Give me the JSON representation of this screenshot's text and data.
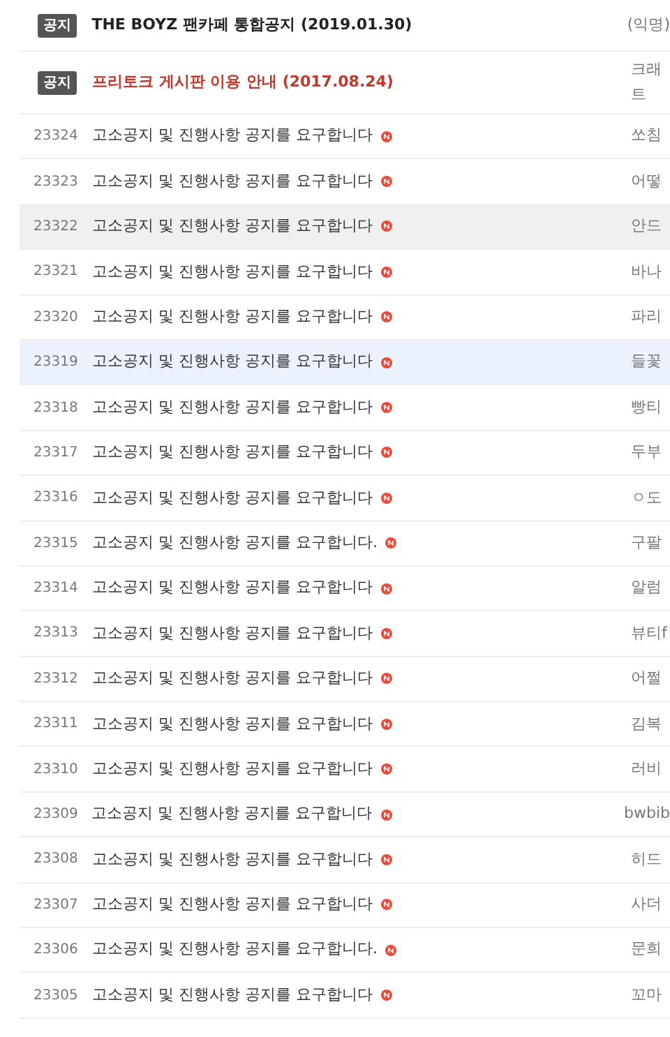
{
  "notices": [
    {
      "badge": "공지",
      "title": "THE BOYZ 팬카페 통합공지 (2019.01.30)",
      "red": false,
      "author": [
        "(익명)"
      ]
    },
    {
      "badge": "공지",
      "title": "프리토크 게시판 이용 안내 (2017.08.24)",
      "red": true,
      "author": [
        "크래",
        "트"
      ]
    }
  ],
  "posts": [
    {
      "number": "23324",
      "title": "고소공지 및 진행사항 공지를 요구합니다",
      "new": true,
      "author": "쏘침",
      "hovered": false,
      "selected": false
    },
    {
      "number": "23323",
      "title": "고소공지 및 진행사항 공지를 요구합니다",
      "new": true,
      "author": "어떻",
      "hovered": false,
      "selected": false
    },
    {
      "number": "23322",
      "title": "고소공지 및 진행사항 공지를 요구합니다",
      "new": true,
      "author": "안드",
      "hovered": true,
      "selected": false
    },
    {
      "number": "23321",
      "title": "고소공지 및 진행사항 공지를 요구합니다",
      "new": true,
      "author": "바나",
      "hovered": false,
      "selected": false
    },
    {
      "number": "23320",
      "title": "고소공지 및 진행사항 공지를 요구합니다",
      "new": true,
      "author": "파리",
      "hovered": false,
      "selected": false
    },
    {
      "number": "23319",
      "title": "고소공지 및 진행사항 공지를 요구합니다",
      "new": true,
      "author": "들꽃",
      "hovered": false,
      "selected": true
    },
    {
      "number": "23318",
      "title": "고소공지 및 진행사항 공지를 요구합니다",
      "new": true,
      "author": "빵티",
      "hovered": false,
      "selected": false
    },
    {
      "number": "23317",
      "title": "고소공지 및 진행사항 공지를 요구합니다",
      "new": true,
      "author": "두부",
      "hovered": false,
      "selected": false
    },
    {
      "number": "23316",
      "title": "고소공지 및 진행사항 공지를 요구합니다",
      "new": true,
      "author": "ㅇ도",
      "hovered": false,
      "selected": false
    },
    {
      "number": "23315",
      "title": "고소공지 및 진행사항 공지를 요구합니다.",
      "new": true,
      "author": "구팔",
      "hovered": false,
      "selected": false
    },
    {
      "number": "23314",
      "title": "고소공지 및 진행사항 공지를 요구합니다",
      "new": true,
      "author": "알럼",
      "hovered": false,
      "selected": false
    },
    {
      "number": "23313",
      "title": "고소공지 및 진행사항 공지를 요구합니다",
      "new": true,
      "author": "뷰티f",
      "hovered": false,
      "selected": false
    },
    {
      "number": "23312",
      "title": "고소공지 및 진행사항 공지를 요구합니다",
      "new": true,
      "author": "어쩔",
      "hovered": false,
      "selected": false
    },
    {
      "number": "23311",
      "title": "고소공지 및 진행사항 공지를 요구합니다",
      "new": true,
      "author": "김복",
      "hovered": false,
      "selected": false
    },
    {
      "number": "23310",
      "title": "고소공지 및 진행사항 공지를 요구합니다",
      "new": true,
      "author": "러비",
      "hovered": false,
      "selected": false
    },
    {
      "number": "23309",
      "title": "고소공지 및 진행사항 공지를 요구합니다",
      "new": true,
      "author": "bwbib",
      "hovered": false,
      "selected": false
    },
    {
      "number": "23308",
      "title": "고소공지 및 진행사항 공지를 요구합니다",
      "new": true,
      "author": "히드",
      "hovered": false,
      "selected": false
    },
    {
      "number": "23307",
      "title": "고소공지 및 진행사항 공지를 요구합니다",
      "new": true,
      "author": "사더",
      "hovered": false,
      "selected": false
    },
    {
      "number": "23306",
      "title": "고소공지 및 진행사항 공지를 요구합니다.",
      "new": true,
      "author": "문희",
      "hovered": false,
      "selected": false
    },
    {
      "number": "23305",
      "title": "고소공지 및 진행사항 공지를 요구합니다",
      "new": true,
      "author": "꼬마",
      "hovered": false,
      "selected": false
    }
  ]
}
